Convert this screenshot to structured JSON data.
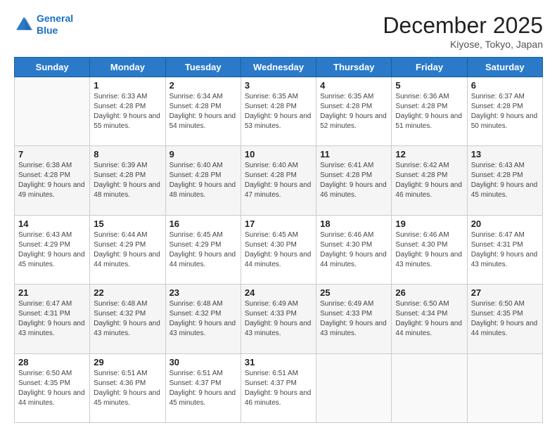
{
  "header": {
    "logo_line1": "General",
    "logo_line2": "Blue",
    "title": "December 2025",
    "subtitle": "Kiyose, Tokyo, Japan"
  },
  "days": [
    "Sunday",
    "Monday",
    "Tuesday",
    "Wednesday",
    "Thursday",
    "Friday",
    "Saturday"
  ],
  "weeks": [
    [
      {
        "day": "",
        "sunrise": "",
        "sunset": "",
        "daylight": ""
      },
      {
        "day": "1",
        "sunrise": "Sunrise: 6:33 AM",
        "sunset": "Sunset: 4:28 PM",
        "daylight": "Daylight: 9 hours and 55 minutes."
      },
      {
        "day": "2",
        "sunrise": "Sunrise: 6:34 AM",
        "sunset": "Sunset: 4:28 PM",
        "daylight": "Daylight: 9 hours and 54 minutes."
      },
      {
        "day": "3",
        "sunrise": "Sunrise: 6:35 AM",
        "sunset": "Sunset: 4:28 PM",
        "daylight": "Daylight: 9 hours and 53 minutes."
      },
      {
        "day": "4",
        "sunrise": "Sunrise: 6:35 AM",
        "sunset": "Sunset: 4:28 PM",
        "daylight": "Daylight: 9 hours and 52 minutes."
      },
      {
        "day": "5",
        "sunrise": "Sunrise: 6:36 AM",
        "sunset": "Sunset: 4:28 PM",
        "daylight": "Daylight: 9 hours and 51 minutes."
      },
      {
        "day": "6",
        "sunrise": "Sunrise: 6:37 AM",
        "sunset": "Sunset: 4:28 PM",
        "daylight": "Daylight: 9 hours and 50 minutes."
      }
    ],
    [
      {
        "day": "7",
        "sunrise": "Sunrise: 6:38 AM",
        "sunset": "Sunset: 4:28 PM",
        "daylight": "Daylight: 9 hours and 49 minutes."
      },
      {
        "day": "8",
        "sunrise": "Sunrise: 6:39 AM",
        "sunset": "Sunset: 4:28 PM",
        "daylight": "Daylight: 9 hours and 48 minutes."
      },
      {
        "day": "9",
        "sunrise": "Sunrise: 6:40 AM",
        "sunset": "Sunset: 4:28 PM",
        "daylight": "Daylight: 9 hours and 48 minutes."
      },
      {
        "day": "10",
        "sunrise": "Sunrise: 6:40 AM",
        "sunset": "Sunset: 4:28 PM",
        "daylight": "Daylight: 9 hours and 47 minutes."
      },
      {
        "day": "11",
        "sunrise": "Sunrise: 6:41 AM",
        "sunset": "Sunset: 4:28 PM",
        "daylight": "Daylight: 9 hours and 46 minutes."
      },
      {
        "day": "12",
        "sunrise": "Sunrise: 6:42 AM",
        "sunset": "Sunset: 4:28 PM",
        "daylight": "Daylight: 9 hours and 46 minutes."
      },
      {
        "day": "13",
        "sunrise": "Sunrise: 6:43 AM",
        "sunset": "Sunset: 4:28 PM",
        "daylight": "Daylight: 9 hours and 45 minutes."
      }
    ],
    [
      {
        "day": "14",
        "sunrise": "Sunrise: 6:43 AM",
        "sunset": "Sunset: 4:29 PM",
        "daylight": "Daylight: 9 hours and 45 minutes."
      },
      {
        "day": "15",
        "sunrise": "Sunrise: 6:44 AM",
        "sunset": "Sunset: 4:29 PM",
        "daylight": "Daylight: 9 hours and 44 minutes."
      },
      {
        "day": "16",
        "sunrise": "Sunrise: 6:45 AM",
        "sunset": "Sunset: 4:29 PM",
        "daylight": "Daylight: 9 hours and 44 minutes."
      },
      {
        "day": "17",
        "sunrise": "Sunrise: 6:45 AM",
        "sunset": "Sunset: 4:30 PM",
        "daylight": "Daylight: 9 hours and 44 minutes."
      },
      {
        "day": "18",
        "sunrise": "Sunrise: 6:46 AM",
        "sunset": "Sunset: 4:30 PM",
        "daylight": "Daylight: 9 hours and 44 minutes."
      },
      {
        "day": "19",
        "sunrise": "Sunrise: 6:46 AM",
        "sunset": "Sunset: 4:30 PM",
        "daylight": "Daylight: 9 hours and 43 minutes."
      },
      {
        "day": "20",
        "sunrise": "Sunrise: 6:47 AM",
        "sunset": "Sunset: 4:31 PM",
        "daylight": "Daylight: 9 hours and 43 minutes."
      }
    ],
    [
      {
        "day": "21",
        "sunrise": "Sunrise: 6:47 AM",
        "sunset": "Sunset: 4:31 PM",
        "daylight": "Daylight: 9 hours and 43 minutes."
      },
      {
        "day": "22",
        "sunrise": "Sunrise: 6:48 AM",
        "sunset": "Sunset: 4:32 PM",
        "daylight": "Daylight: 9 hours and 43 minutes."
      },
      {
        "day": "23",
        "sunrise": "Sunrise: 6:48 AM",
        "sunset": "Sunset: 4:32 PM",
        "daylight": "Daylight: 9 hours and 43 minutes."
      },
      {
        "day": "24",
        "sunrise": "Sunrise: 6:49 AM",
        "sunset": "Sunset: 4:33 PM",
        "daylight": "Daylight: 9 hours and 43 minutes."
      },
      {
        "day": "25",
        "sunrise": "Sunrise: 6:49 AM",
        "sunset": "Sunset: 4:33 PM",
        "daylight": "Daylight: 9 hours and 43 minutes."
      },
      {
        "day": "26",
        "sunrise": "Sunrise: 6:50 AM",
        "sunset": "Sunset: 4:34 PM",
        "daylight": "Daylight: 9 hours and 44 minutes."
      },
      {
        "day": "27",
        "sunrise": "Sunrise: 6:50 AM",
        "sunset": "Sunset: 4:35 PM",
        "daylight": "Daylight: 9 hours and 44 minutes."
      }
    ],
    [
      {
        "day": "28",
        "sunrise": "Sunrise: 6:50 AM",
        "sunset": "Sunset: 4:35 PM",
        "daylight": "Daylight: 9 hours and 44 minutes."
      },
      {
        "day": "29",
        "sunrise": "Sunrise: 6:51 AM",
        "sunset": "Sunset: 4:36 PM",
        "daylight": "Daylight: 9 hours and 45 minutes."
      },
      {
        "day": "30",
        "sunrise": "Sunrise: 6:51 AM",
        "sunset": "Sunset: 4:37 PM",
        "daylight": "Daylight: 9 hours and 45 minutes."
      },
      {
        "day": "31",
        "sunrise": "Sunrise: 6:51 AM",
        "sunset": "Sunset: 4:37 PM",
        "daylight": "Daylight: 9 hours and 46 minutes."
      },
      {
        "day": "",
        "sunrise": "",
        "sunset": "",
        "daylight": ""
      },
      {
        "day": "",
        "sunrise": "",
        "sunset": "",
        "daylight": ""
      },
      {
        "day": "",
        "sunrise": "",
        "sunset": "",
        "daylight": ""
      }
    ]
  ]
}
